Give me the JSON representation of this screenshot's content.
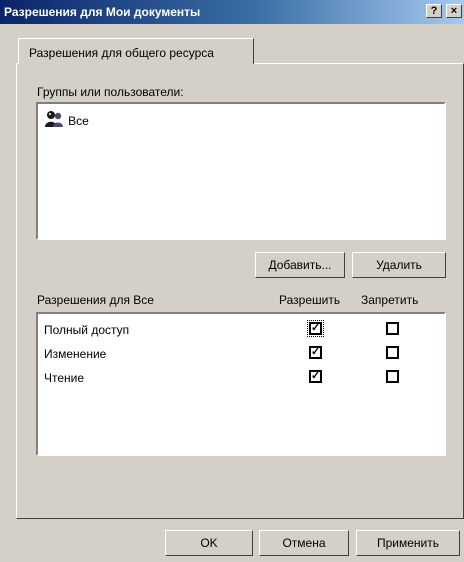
{
  "window": {
    "title": "Разрешения для Мои документы",
    "help_label": "?",
    "close_label": "×"
  },
  "tab": {
    "label": "Разрешения для общего ресурса"
  },
  "groups": {
    "label": "Группы или пользователи:",
    "items": [
      {
        "name": "Все",
        "icon": "users-group-icon"
      }
    ]
  },
  "buttons": {
    "add": "Добавить...",
    "remove": "Удалить",
    "ok": "OK",
    "cancel": "Отмена",
    "apply": "Применить"
  },
  "permissions": {
    "label": "Разрешения для Все",
    "allow_header": "Разрешить",
    "deny_header": "Запретить",
    "rows": [
      {
        "name": "Полный доступ",
        "allow": true,
        "deny": false
      },
      {
        "name": "Изменение",
        "allow": true,
        "deny": false
      },
      {
        "name": "Чтение",
        "allow": true,
        "deny": false
      }
    ]
  }
}
